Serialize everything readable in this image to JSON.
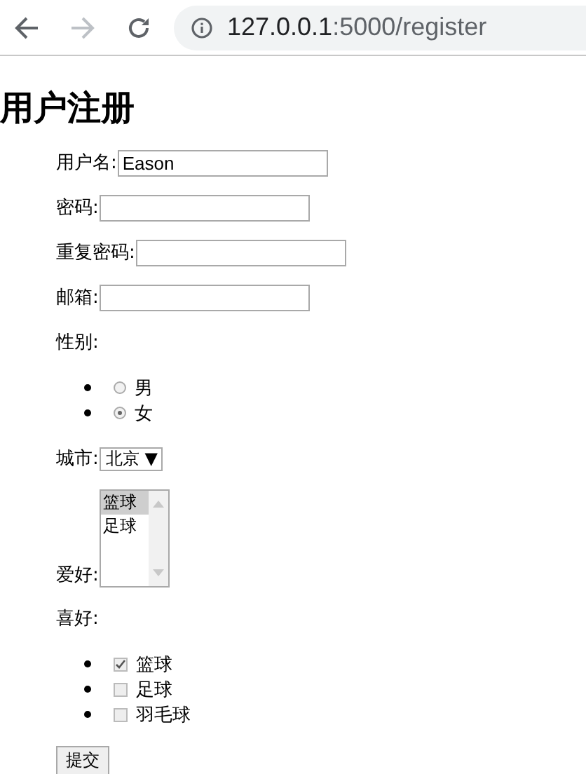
{
  "browser": {
    "back_enabled": true,
    "forward_enabled": false,
    "url_host": "127.0.0.1",
    "url_rest": ":5000/register"
  },
  "title": "用户注册",
  "fields": [
    {
      "label": "用户名:",
      "value": "Eason"
    },
    {
      "label": "密码:"
    },
    {
      "label": "重复密码:"
    },
    {
      "label": "邮箱:"
    }
  ],
  "gender": {
    "label": "性别:",
    "options": [
      {
        "label": "男",
        "selected": false
      },
      {
        "label": "女",
        "selected": true
      }
    ]
  },
  "city": {
    "label": "城市:",
    "value": "北京",
    "arrow": "▼"
  },
  "hobby_list": {
    "label": "爱好:",
    "options": [
      {
        "label": "篮球",
        "selected": true
      },
      {
        "label": "足球",
        "selected": false
      }
    ]
  },
  "likes": {
    "label": "喜好:",
    "options": [
      {
        "label": "篮球",
        "checked": true
      },
      {
        "label": "足球",
        "checked": false
      },
      {
        "label": "羽毛球",
        "checked": false
      }
    ]
  },
  "submit": "提交"
}
